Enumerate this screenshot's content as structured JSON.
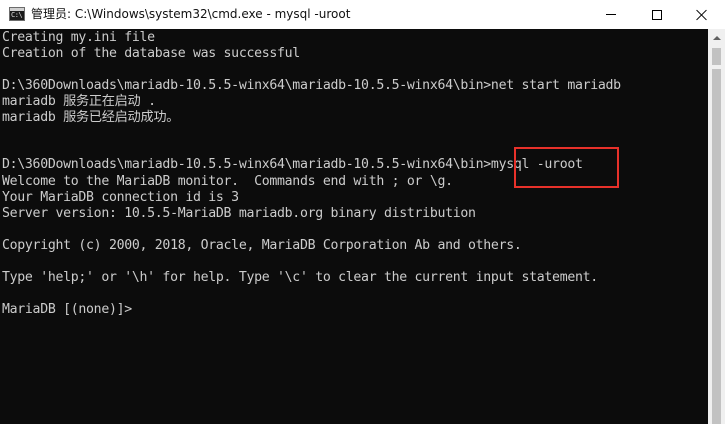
{
  "window": {
    "title": "管理员: C:\\Windows\\system32\\cmd.exe - mysql  -uroot",
    "icon": "cmd-icon",
    "icon_text": "C:\\"
  },
  "console": {
    "lines": [
      "Creating my.ini file",
      "Creation of the database was successful",
      "",
      "D:\\360Downloads\\mariadb-10.5.5-winx64\\mariadb-10.5.5-winx64\\bin>net start mariadb",
      "mariadb 服务正在启动 .",
      "mariadb 服务已经启动成功。",
      "",
      "",
      "D:\\360Downloads\\mariadb-10.5.5-winx64\\mariadb-10.5.5-winx64\\bin>mysql -uroot",
      "Welcome to the MariaDB monitor.  Commands end with ; or \\g.",
      "Your MariaDB connection id is 3",
      "Server version: 10.5.5-MariaDB mariadb.org binary distribution",
      "",
      "Copyright (c) 2000, 2018, Oracle, MariaDB Corporation Ab and others.",
      "",
      "Type 'help;' or '\\h' for help. Type '\\c' to clear the current input statement.",
      "",
      "MariaDB [(none)]>"
    ]
  },
  "colors": {
    "console_bg": "#0c0c0c",
    "console_text": "#cccccc",
    "highlight": "#e8312a",
    "titlebar_bg": "#ffffff"
  }
}
